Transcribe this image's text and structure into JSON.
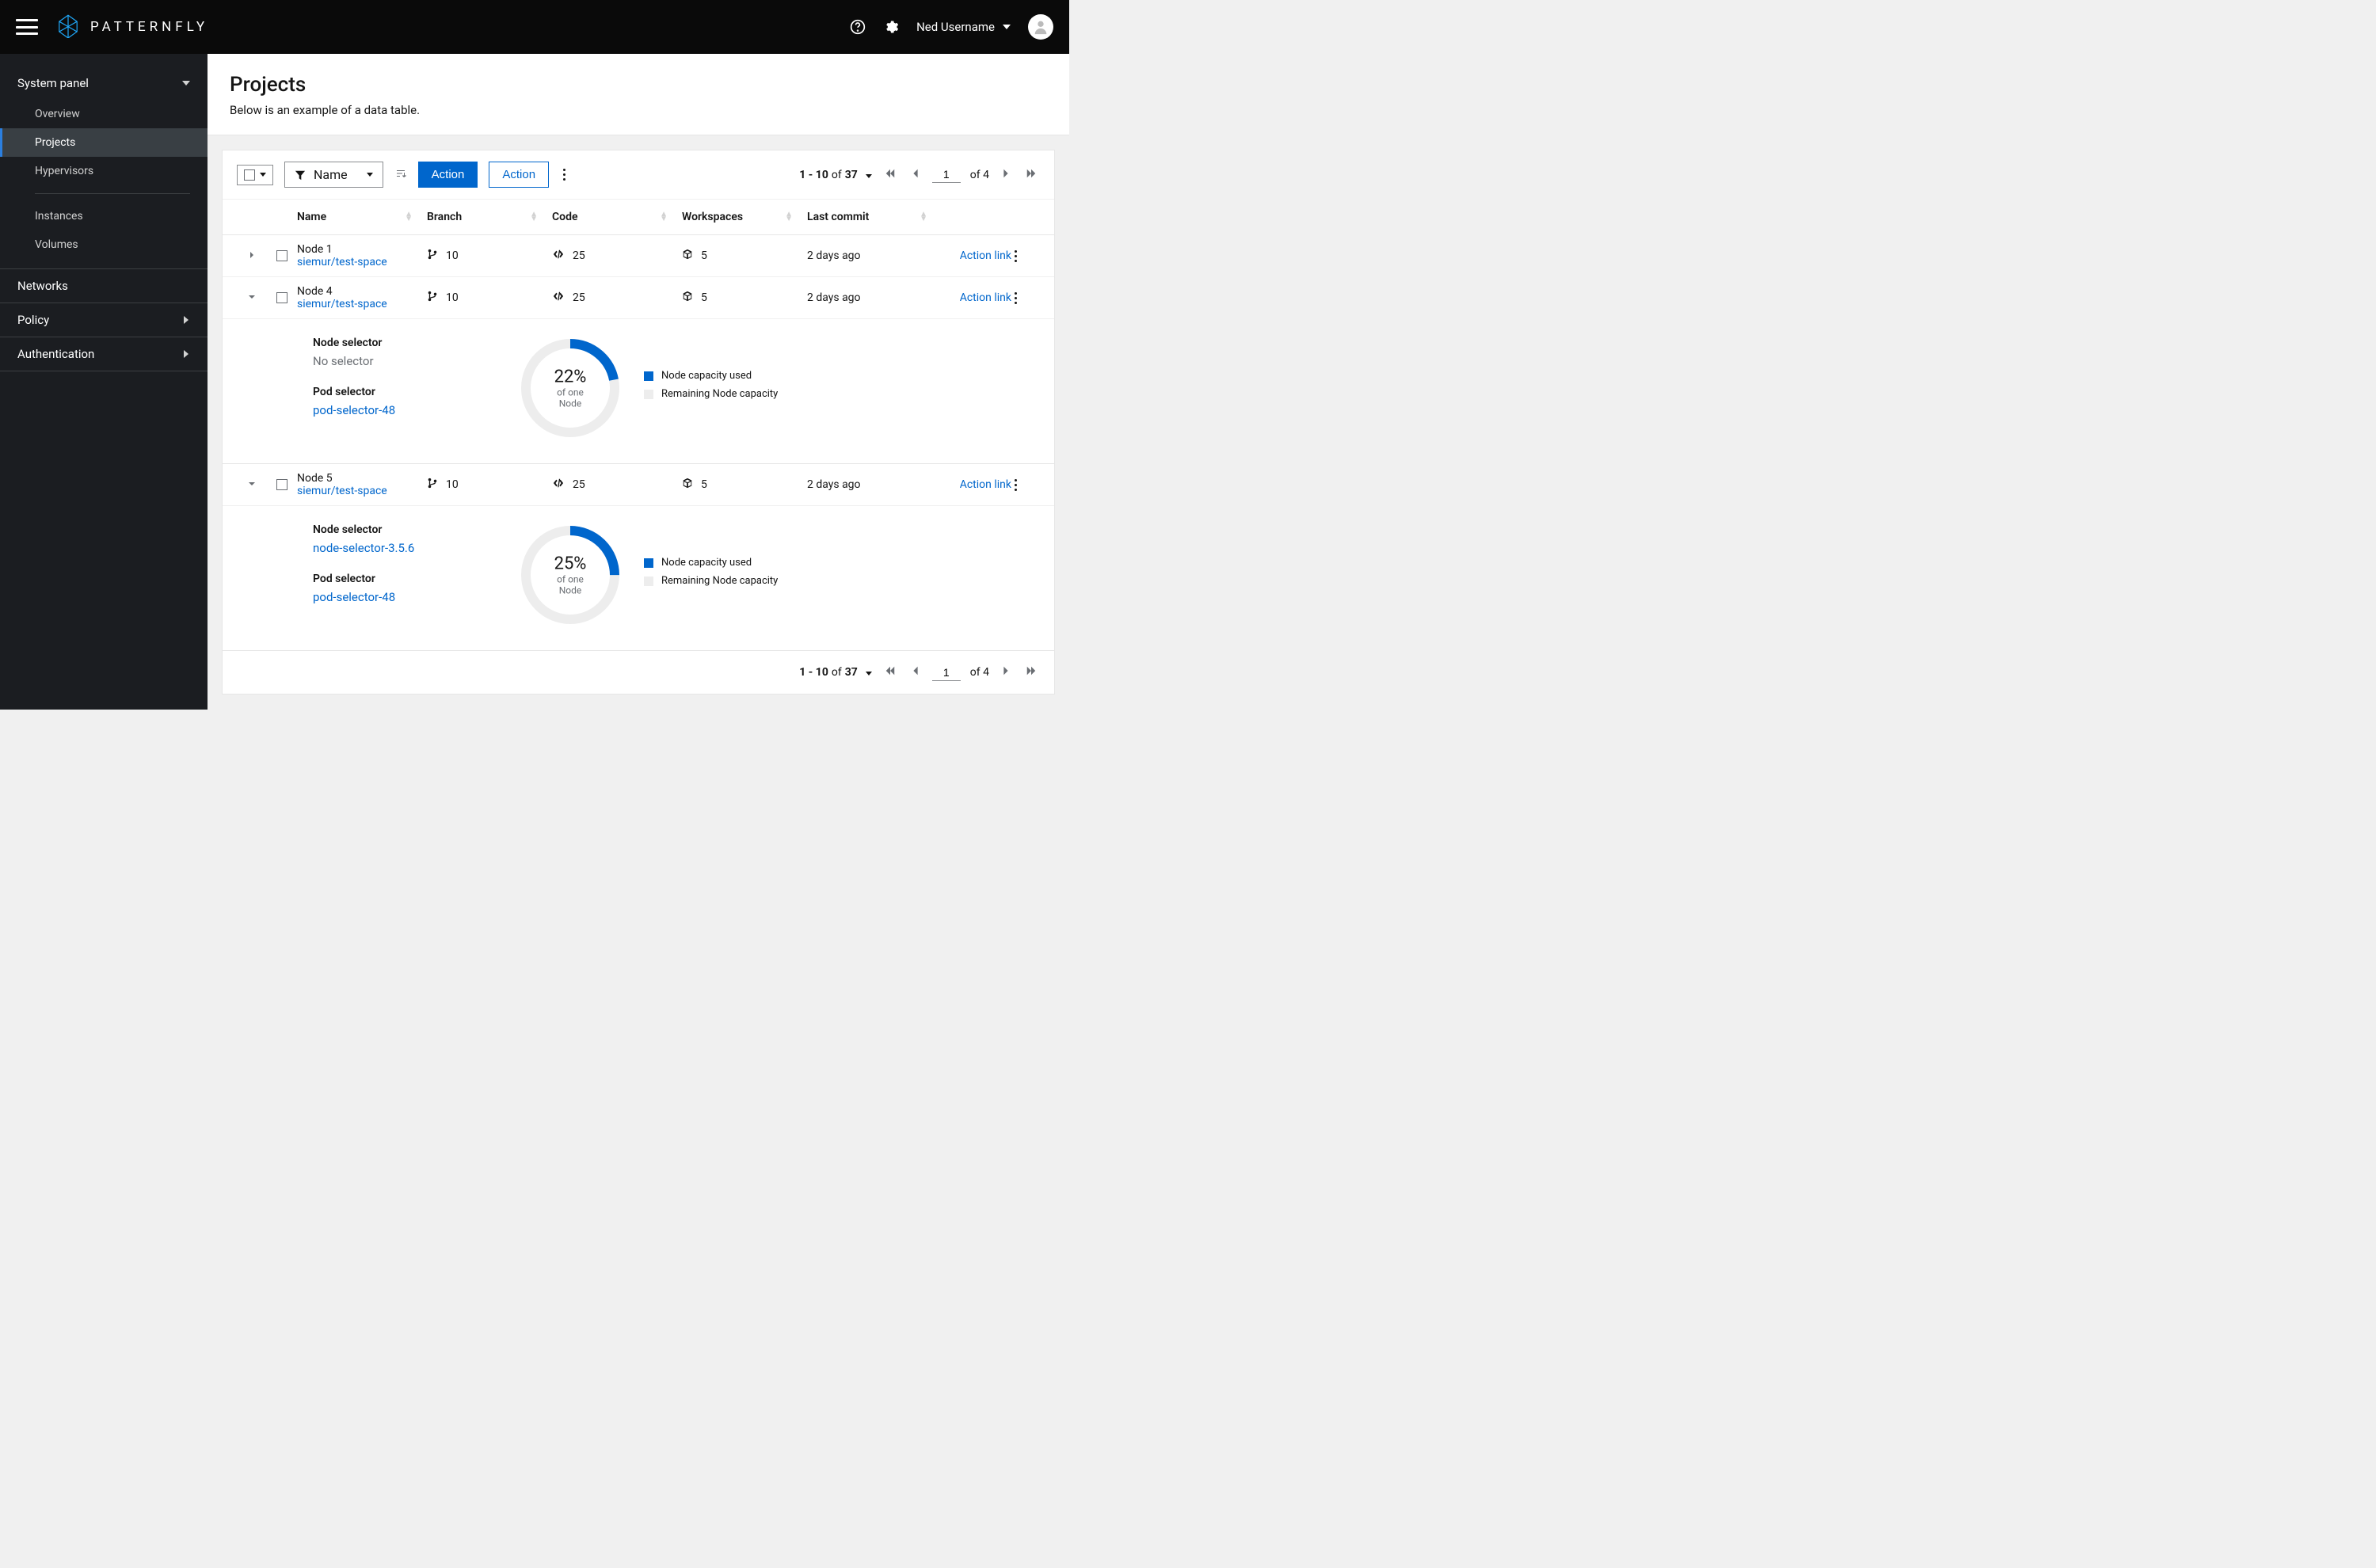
{
  "header": {
    "brand": "PATTERNFLY",
    "username": "Ned Username"
  },
  "sidebar": {
    "system_panel": "System panel",
    "items": {
      "overview": "Overview",
      "projects": "Projects",
      "hypervisors": "Hypervisors",
      "instances": "Instances",
      "volumes": "Volumes"
    },
    "networks": "Networks",
    "policy": "Policy",
    "authentication": "Authentication"
  },
  "page": {
    "title": "Projects",
    "description": "Below is an example of a data table."
  },
  "toolbar": {
    "filter_label": "Name",
    "action_primary": "Action",
    "action_secondary": "Action"
  },
  "pagination": {
    "range": "1 - 10",
    "of_word": "of",
    "total": "37",
    "page": "1",
    "pages": "of 4"
  },
  "columns": {
    "name": "Name",
    "branch": "Branch",
    "code": "Code",
    "workspaces": "Workspaces",
    "last_commit": "Last commit"
  },
  "rows": [
    {
      "name": "Node 1",
      "sub": "siemur/test-space",
      "branch": "10",
      "code": "25",
      "workspaces": "5",
      "last_commit": "2 days ago",
      "action": "Action link",
      "expanded": false
    },
    {
      "name": "Node 4",
      "sub": "siemur/test-space",
      "branch": "10",
      "code": "25",
      "workspaces": "5",
      "last_commit": "2 days ago",
      "action": "Action link",
      "expanded": true,
      "detail": {
        "node_selector_label": "Node selector",
        "node_selector_value": "No selector",
        "node_selector_muted": true,
        "pod_selector_label": "Pod selector",
        "pod_selector_value": "pod-selector-48",
        "pct": 22,
        "pct_label": "22%",
        "pct_sub": "of one Node",
        "legend_used": "Node capacity used",
        "legend_remaining": "Remaining Node capacity"
      }
    },
    {
      "name": "Node 5",
      "sub": "siemur/test-space",
      "branch": "10",
      "code": "25",
      "workspaces": "5",
      "last_commit": "2 days ago",
      "action": "Action link",
      "expanded": true,
      "detail": {
        "node_selector_label": "Node selector",
        "node_selector_value": "node-selector-3.5.6",
        "node_selector_muted": false,
        "pod_selector_label": "Pod selector",
        "pod_selector_value": "pod-selector-48",
        "pct": 25,
        "pct_label": "25%",
        "pct_sub": "of one Node",
        "legend_used": "Node capacity used",
        "legend_remaining": "Remaining Node capacity"
      }
    }
  ],
  "colors": {
    "primary": "#0066cc",
    "donut_track": "#ededed"
  }
}
